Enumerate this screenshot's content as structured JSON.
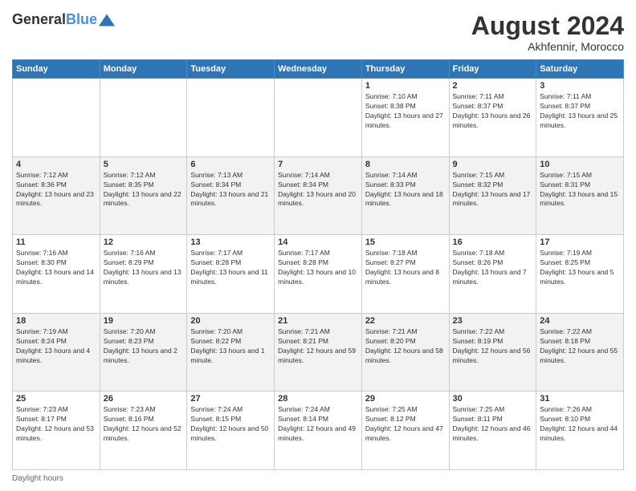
{
  "header": {
    "logo_line1": "General",
    "logo_line2": "Blue",
    "month_year": "August 2024",
    "location": "Akhfennir, Morocco"
  },
  "days_of_week": [
    "Sunday",
    "Monday",
    "Tuesday",
    "Wednesday",
    "Thursday",
    "Friday",
    "Saturday"
  ],
  "weeks": [
    [
      {
        "day": "",
        "info": ""
      },
      {
        "day": "",
        "info": ""
      },
      {
        "day": "",
        "info": ""
      },
      {
        "day": "",
        "info": ""
      },
      {
        "day": "1",
        "info": "Sunrise: 7:10 AM\nSunset: 8:38 PM\nDaylight: 13 hours and 27 minutes."
      },
      {
        "day": "2",
        "info": "Sunrise: 7:11 AM\nSunset: 8:37 PM\nDaylight: 13 hours and 26 minutes."
      },
      {
        "day": "3",
        "info": "Sunrise: 7:11 AM\nSunset: 8:37 PM\nDaylight: 13 hours and 25 minutes."
      }
    ],
    [
      {
        "day": "4",
        "info": "Sunrise: 7:12 AM\nSunset: 8:36 PM\nDaylight: 13 hours and 23 minutes."
      },
      {
        "day": "5",
        "info": "Sunrise: 7:12 AM\nSunset: 8:35 PM\nDaylight: 13 hours and 22 minutes."
      },
      {
        "day": "6",
        "info": "Sunrise: 7:13 AM\nSunset: 8:34 PM\nDaylight: 13 hours and 21 minutes."
      },
      {
        "day": "7",
        "info": "Sunrise: 7:14 AM\nSunset: 8:34 PM\nDaylight: 13 hours and 20 minutes."
      },
      {
        "day": "8",
        "info": "Sunrise: 7:14 AM\nSunset: 8:33 PM\nDaylight: 13 hours and 18 minutes."
      },
      {
        "day": "9",
        "info": "Sunrise: 7:15 AM\nSunset: 8:32 PM\nDaylight: 13 hours and 17 minutes."
      },
      {
        "day": "10",
        "info": "Sunrise: 7:15 AM\nSunset: 8:31 PM\nDaylight: 13 hours and 15 minutes."
      }
    ],
    [
      {
        "day": "11",
        "info": "Sunrise: 7:16 AM\nSunset: 8:30 PM\nDaylight: 13 hours and 14 minutes."
      },
      {
        "day": "12",
        "info": "Sunrise: 7:16 AM\nSunset: 8:29 PM\nDaylight: 13 hours and 13 minutes."
      },
      {
        "day": "13",
        "info": "Sunrise: 7:17 AM\nSunset: 8:28 PM\nDaylight: 13 hours and 11 minutes."
      },
      {
        "day": "14",
        "info": "Sunrise: 7:17 AM\nSunset: 8:28 PM\nDaylight: 13 hours and 10 minutes."
      },
      {
        "day": "15",
        "info": "Sunrise: 7:18 AM\nSunset: 8:27 PM\nDaylight: 13 hours and 8 minutes."
      },
      {
        "day": "16",
        "info": "Sunrise: 7:18 AM\nSunset: 8:26 PM\nDaylight: 13 hours and 7 minutes."
      },
      {
        "day": "17",
        "info": "Sunrise: 7:19 AM\nSunset: 8:25 PM\nDaylight: 13 hours and 5 minutes."
      }
    ],
    [
      {
        "day": "18",
        "info": "Sunrise: 7:19 AM\nSunset: 8:24 PM\nDaylight: 13 hours and 4 minutes."
      },
      {
        "day": "19",
        "info": "Sunrise: 7:20 AM\nSunset: 8:23 PM\nDaylight: 13 hours and 2 minutes."
      },
      {
        "day": "20",
        "info": "Sunrise: 7:20 AM\nSunset: 8:22 PM\nDaylight: 13 hours and 1 minute."
      },
      {
        "day": "21",
        "info": "Sunrise: 7:21 AM\nSunset: 8:21 PM\nDaylight: 12 hours and 59 minutes."
      },
      {
        "day": "22",
        "info": "Sunrise: 7:21 AM\nSunset: 8:20 PM\nDaylight: 12 hours and 58 minutes."
      },
      {
        "day": "23",
        "info": "Sunrise: 7:22 AM\nSunset: 8:19 PM\nDaylight: 12 hours and 56 minutes."
      },
      {
        "day": "24",
        "info": "Sunrise: 7:22 AM\nSunset: 8:18 PM\nDaylight: 12 hours and 55 minutes."
      }
    ],
    [
      {
        "day": "25",
        "info": "Sunrise: 7:23 AM\nSunset: 8:17 PM\nDaylight: 12 hours and 53 minutes."
      },
      {
        "day": "26",
        "info": "Sunrise: 7:23 AM\nSunset: 8:16 PM\nDaylight: 12 hours and 52 minutes."
      },
      {
        "day": "27",
        "info": "Sunrise: 7:24 AM\nSunset: 8:15 PM\nDaylight: 12 hours and 50 minutes."
      },
      {
        "day": "28",
        "info": "Sunrise: 7:24 AM\nSunset: 8:14 PM\nDaylight: 12 hours and 49 minutes."
      },
      {
        "day": "29",
        "info": "Sunrise: 7:25 AM\nSunset: 8:12 PM\nDaylight: 12 hours and 47 minutes."
      },
      {
        "day": "30",
        "info": "Sunrise: 7:25 AM\nSunset: 8:11 PM\nDaylight: 12 hours and 46 minutes."
      },
      {
        "day": "31",
        "info": "Sunrise: 7:26 AM\nSunset: 8:10 PM\nDaylight: 12 hours and 44 minutes."
      }
    ]
  ],
  "footer": {
    "label": "Daylight hours"
  }
}
